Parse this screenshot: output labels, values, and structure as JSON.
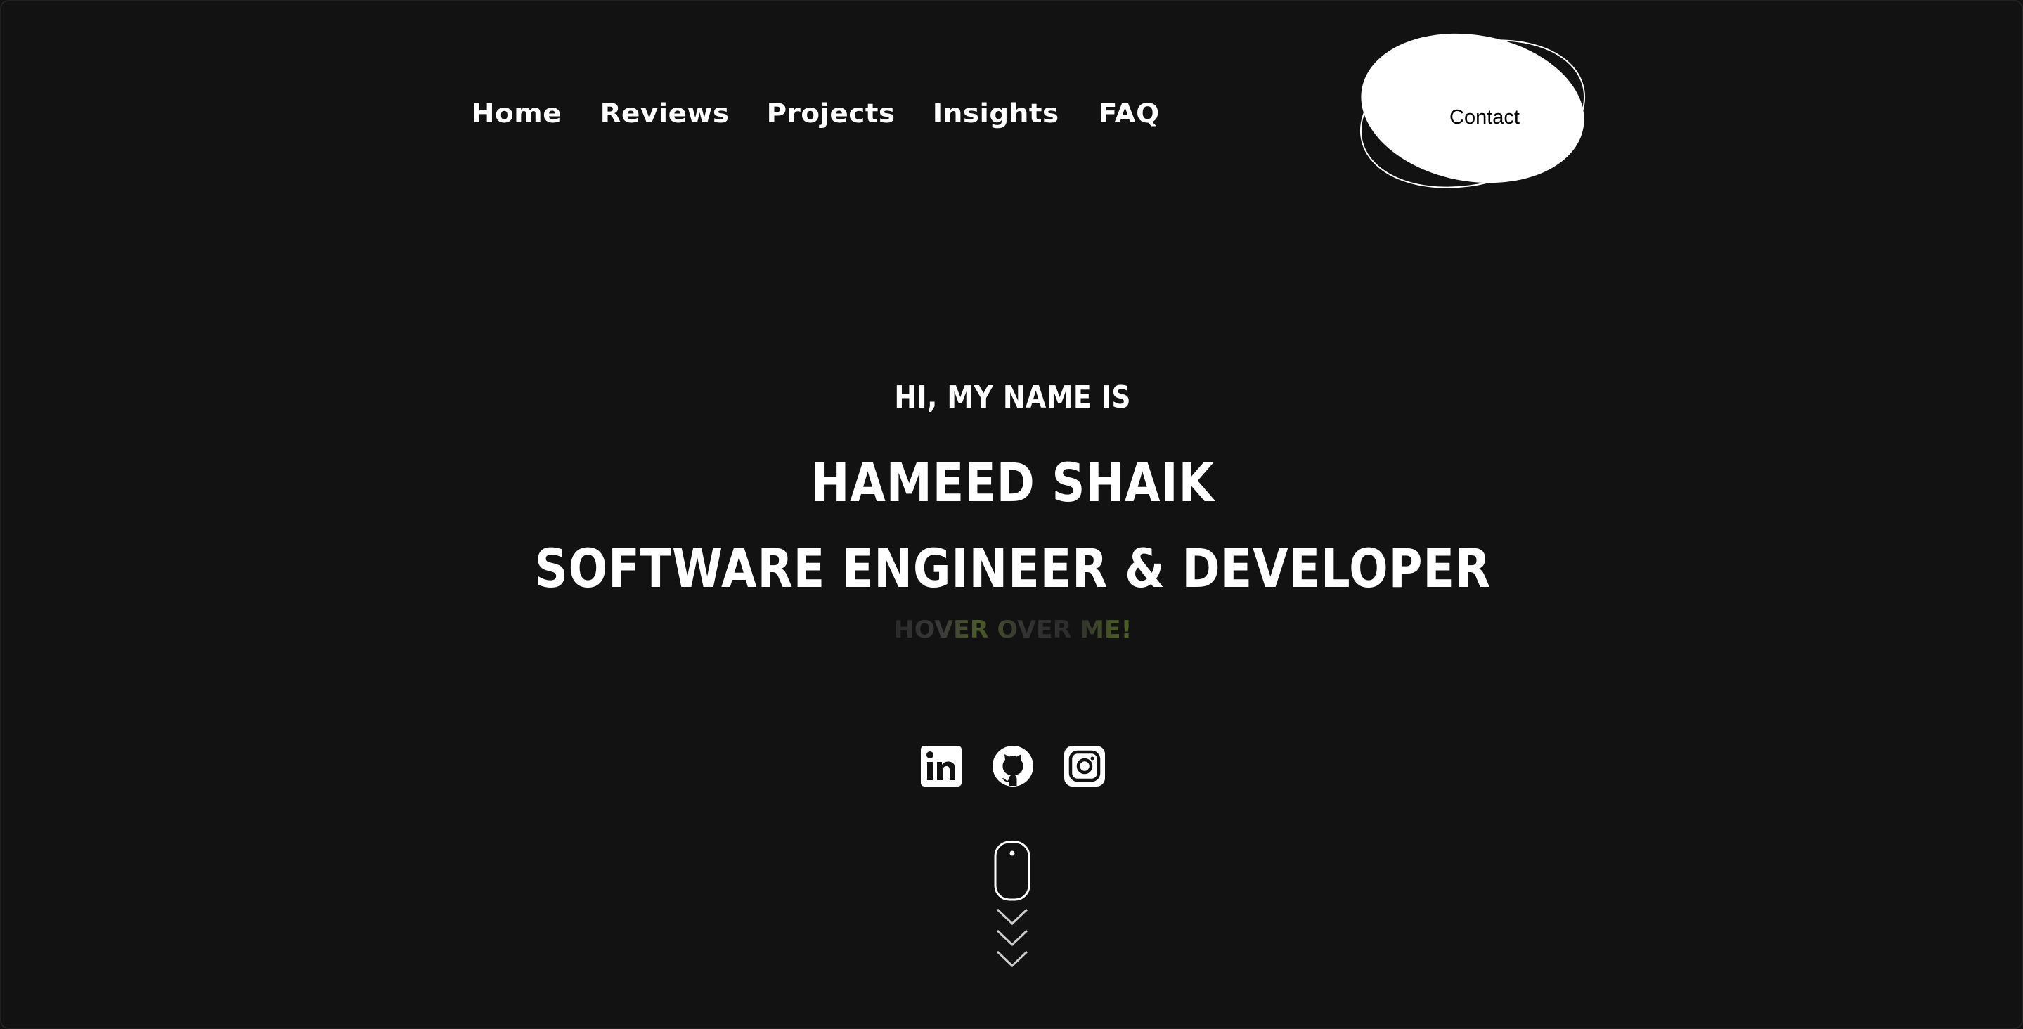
{
  "nav": {
    "items": [
      {
        "label": "Home"
      },
      {
        "label": "Reviews"
      },
      {
        "label": "Projects"
      },
      {
        "label": "Insights"
      },
      {
        "label": "FAQ"
      }
    ],
    "contact_label": "Contact"
  },
  "hero": {
    "greeting": "HI, MY NAME IS",
    "name": "HAMEED SHAIK",
    "role": "SOFTWARE ENGINEER & DEVELOPER",
    "hover_hint": "HOVER OVER ME!"
  },
  "socials": [
    {
      "icon": "linkedin-icon"
    },
    {
      "icon": "github-icon"
    },
    {
      "icon": "instagram-icon"
    }
  ],
  "colors": {
    "background": "#121212",
    "text": "#ffffff",
    "contact_fill": "#ffffff",
    "contact_text": "#000000"
  }
}
